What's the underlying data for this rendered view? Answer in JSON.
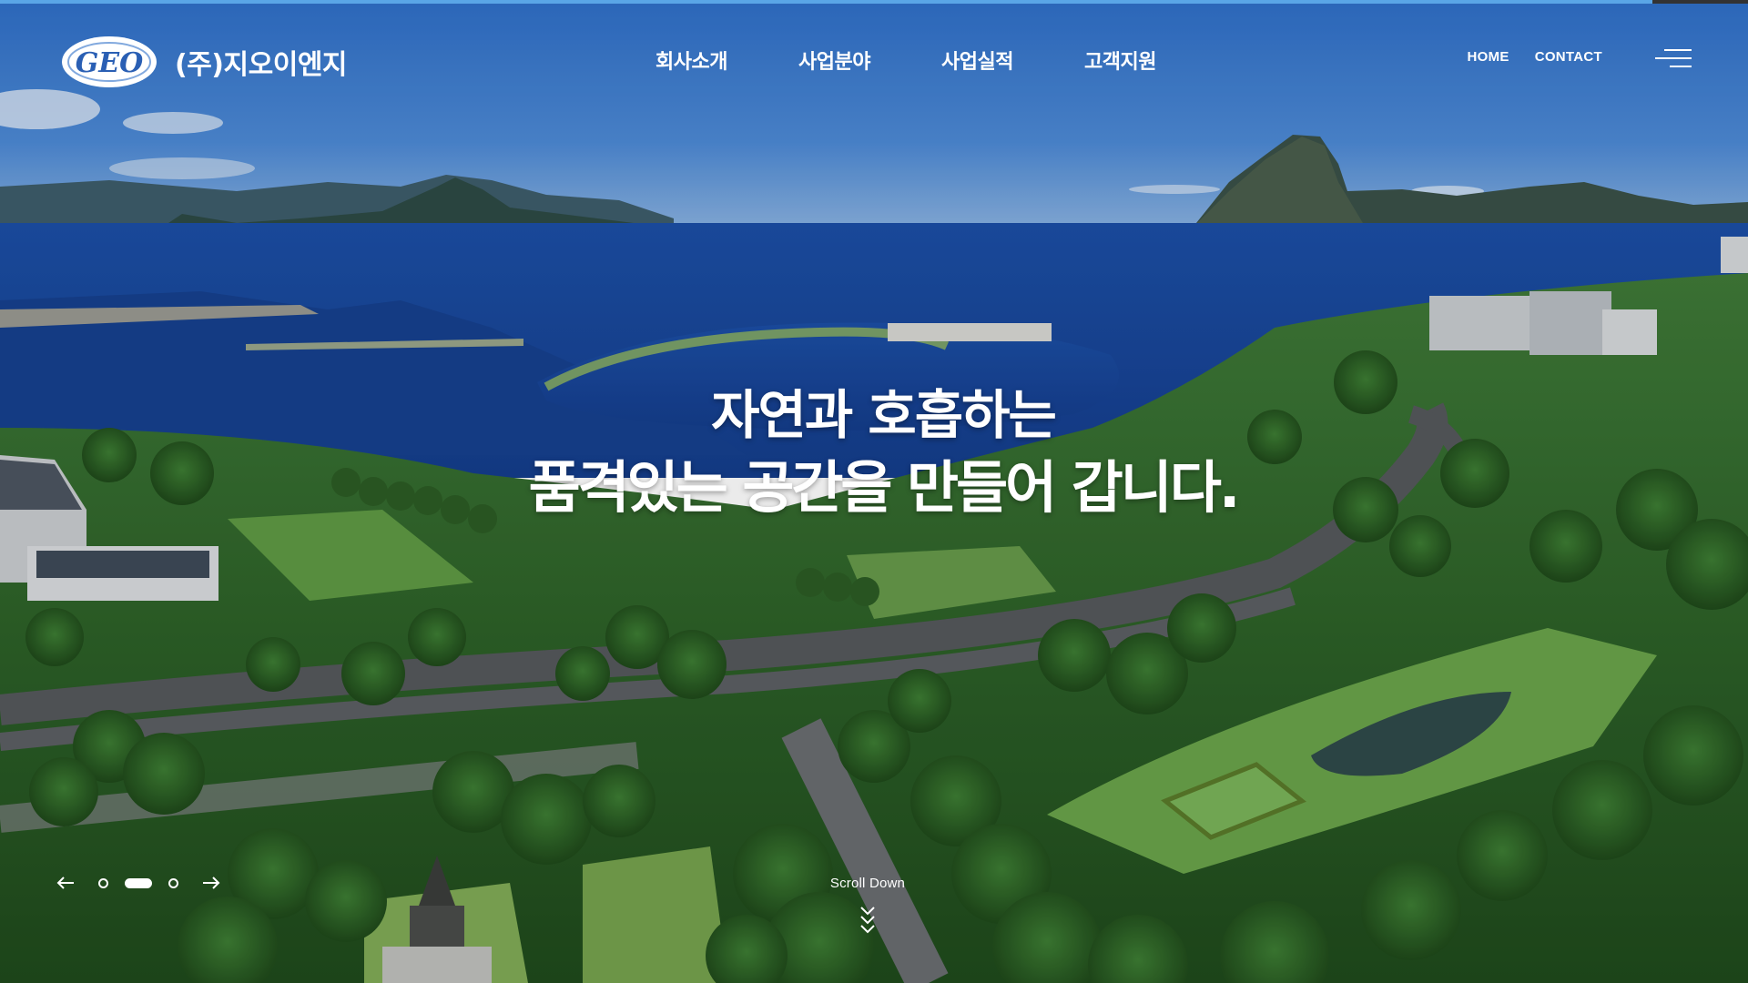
{
  "header": {
    "company_name": "(주)지오이엔지",
    "logo_text": "GEO",
    "nav": [
      {
        "label": "회사소개"
      },
      {
        "label": "사업분야"
      },
      {
        "label": "사업실적"
      },
      {
        "label": "고객지원"
      }
    ],
    "util_links": [
      {
        "label": "HOME"
      },
      {
        "label": "CONTACT"
      }
    ],
    "menu_icon": "hamburger-menu-icon"
  },
  "hero": {
    "headline_line1": "자연과 호흡하는",
    "headline_line2": "품격있는 공간을 만들어 갑니다.",
    "background": "aerial-bay-city-park-photo"
  },
  "slider": {
    "slide_count": 3,
    "active_index": 1,
    "prev_icon": "arrow-left-icon",
    "next_icon": "arrow-right-icon"
  },
  "scroll": {
    "label": "Scroll Down",
    "icon": "double-chevron-down-icon"
  },
  "colors": {
    "top_accent": "#5aa6e6",
    "sky": "#3f7fd0",
    "sea": "#17449a",
    "park_green": "#2f6b2a"
  }
}
